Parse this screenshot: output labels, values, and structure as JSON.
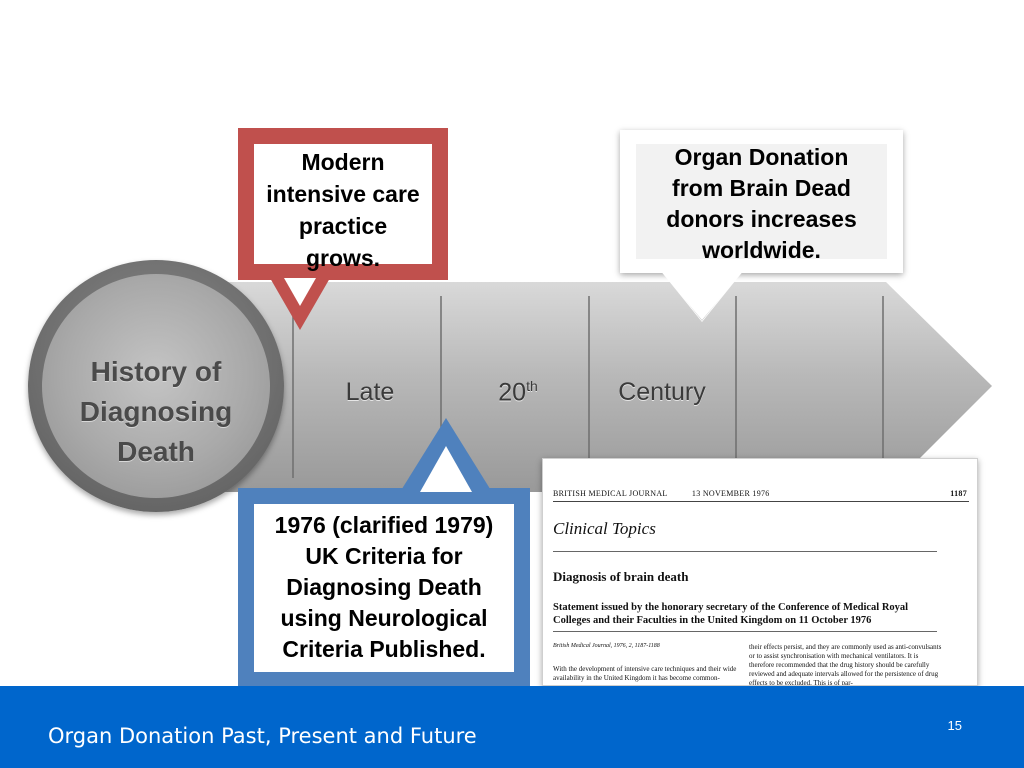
{
  "circle": {
    "lines": [
      "History of",
      "Diagnosing",
      "Death"
    ]
  },
  "timeline": {
    "word1": "Late",
    "word2_base": "20",
    "word2_sup": "th",
    "word3": "Century"
  },
  "callouts": {
    "red": [
      "Modern",
      "intensive care",
      "practice",
      "grows."
    ],
    "white": [
      "Organ Donation",
      "from Brain Dead",
      "donors increases",
      "worldwide."
    ],
    "blue": [
      "1976 (clarified 1979)",
      "UK Criteria for",
      "Diagnosing Death",
      "using Neurological",
      "Criteria Published."
    ]
  },
  "clipping": {
    "journal": "BRITISH MEDICAL JOURNAL",
    "date": "13 NOVEMBER 1976",
    "page": "1187",
    "section": "Clinical Topics",
    "title": "Diagnosis of brain death",
    "statement": "Statement issued by the honorary secretary of the Conference of Medical Royal Colleges and their Faculties in the United Kingdom on 11 October 1976",
    "citation": "British Medical Journal, 1976, 2, 1187-1188",
    "col1": "With the development of intensive care techniques and their wide availability in the United Kingdom it has become common-",
    "col2": "their effects persist, and they are commonly used as anti-convulsants or to assist synchronisation with mechanical ventilators. It is therefore recommended that the drug history should be carefully reviewed and adequate intervals allowed for the persistence of drug effects to be excluded. This is of par-"
  },
  "footer": {
    "title": "Organ Donation Past, Present and Future",
    "page_number": "15"
  },
  "colors": {
    "red_callout": "#c0504d",
    "blue_callout": "#4f81bd",
    "footer_bg": "#0066cc",
    "band_gray": "#a6a6a6"
  }
}
